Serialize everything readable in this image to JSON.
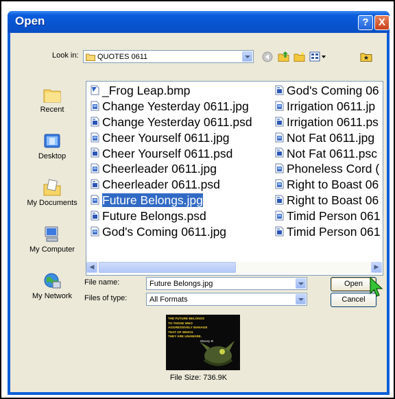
{
  "dialog": {
    "title": "Open"
  },
  "titlebar_buttons": {
    "help": "?",
    "close": "X"
  },
  "lookin": {
    "label": "Look in:",
    "value": "QUOTES 0611"
  },
  "places": [
    {
      "label": "Recent",
      "icon": "recent-icon"
    },
    {
      "label": "Desktop",
      "icon": "desktop-icon"
    },
    {
      "label": "My Documents",
      "icon": "my-documents-icon"
    },
    {
      "label": "My Computer",
      "icon": "my-computer-icon"
    },
    {
      "label": "My Network",
      "icon": "my-network-icon"
    }
  ],
  "files": {
    "column1": [
      {
        "name": "_Frog Leap.bmp",
        "icon": "bmp-file-icon"
      },
      {
        "name": "Change Yesterday 0611.jpg",
        "icon": "jpg-file-icon"
      },
      {
        "name": "Change Yesterday 0611.psd",
        "icon": "psd-file-icon"
      },
      {
        "name": "Cheer Yourself 0611.jpg",
        "icon": "jpg-file-icon"
      },
      {
        "name": "Cheer Yourself 0611.psd",
        "icon": "psd-file-icon"
      },
      {
        "name": "Cheerleader 0611.jpg",
        "icon": "jpg-file-icon"
      },
      {
        "name": "Cheerleader 0611.psd",
        "icon": "psd-file-icon"
      },
      {
        "name": "Future Belongs.jpg",
        "icon": "jpg-file-icon",
        "selected": true
      },
      {
        "name": "Future Belongs.psd",
        "icon": "psd-file-icon"
      },
      {
        "name": "God's Coming 0611.jpg",
        "icon": "jpg-file-icon"
      }
    ],
    "column2": [
      {
        "name": "God's Coming 06",
        "icon": "psd-file-icon"
      },
      {
        "name": "Irrigation 0611.jp",
        "icon": "jpg-file-icon"
      },
      {
        "name": "Irrigation 0611.ps",
        "icon": "psd-file-icon"
      },
      {
        "name": "Not Fat 0611.jpg",
        "icon": "jpg-file-icon"
      },
      {
        "name": "Not Fat 0611.psc",
        "icon": "psd-file-icon"
      },
      {
        "name": "Phoneless Cord (",
        "icon": "jpg-file-icon"
      },
      {
        "name": "Right to Boast 06",
        "icon": "jpg-file-icon"
      },
      {
        "name": "Right to Boast 06",
        "icon": "psd-file-icon"
      },
      {
        "name": "Timid Person 061",
        "icon": "jpg-file-icon"
      },
      {
        "name": "Timid Person 061",
        "icon": "psd-file-icon"
      }
    ]
  },
  "filename": {
    "label": "File name:",
    "value": "Future Belongs.jpg"
  },
  "filetype": {
    "label": "Files of type:",
    "value": "All Formats"
  },
  "buttons": {
    "open": "Open",
    "cancel": "Cancel"
  },
  "preview": {
    "lines": [
      "THE FUTURE BELONGS",
      "TO THOSE WHO",
      "AGGRESSIVELY MANAGE",
      "THAT OF WHICH",
      "THEY ARE UNAWARE."
    ],
    "signature": "Stacey B"
  },
  "filesize": "File Size: 736.9K",
  "colors": {
    "titlebar": "#0a5fd8",
    "selection": "#316ac5",
    "dialog_bg": "#ece9d8",
    "close": "#c6411b"
  }
}
